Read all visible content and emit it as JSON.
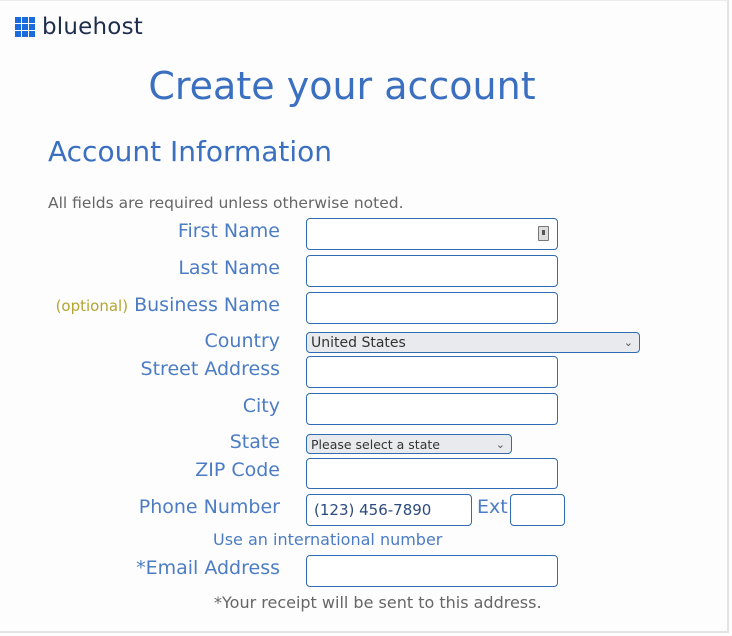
{
  "brand": {
    "name": "bluehost",
    "logo_icon": "grid-icon",
    "accent": "#196bde"
  },
  "page_title": "Create your account",
  "section_title": "Account Information",
  "required_note": "All fields are required unless otherwise noted.",
  "fields": {
    "first_name": {
      "label": "First Name",
      "value": ""
    },
    "last_name": {
      "label": "Last Name",
      "value": ""
    },
    "business_name": {
      "optional_tag": "(optional)",
      "label": "Business Name",
      "value": ""
    },
    "country": {
      "label": "Country",
      "selected": "United States"
    },
    "street": {
      "label": "Street Address",
      "value": ""
    },
    "city": {
      "label": "City",
      "value": ""
    },
    "state": {
      "label": "State",
      "selected": "Please select a state"
    },
    "zip": {
      "label": "ZIP Code",
      "value": ""
    },
    "phone": {
      "label": "Phone Number",
      "value": "(123) 456-7890",
      "ext_label": "Ext",
      "ext_value": ""
    },
    "intl_link": "Use an international number",
    "email": {
      "label": "*Email Address",
      "value": "",
      "note": "*Your receipt will be sent to this address."
    }
  }
}
